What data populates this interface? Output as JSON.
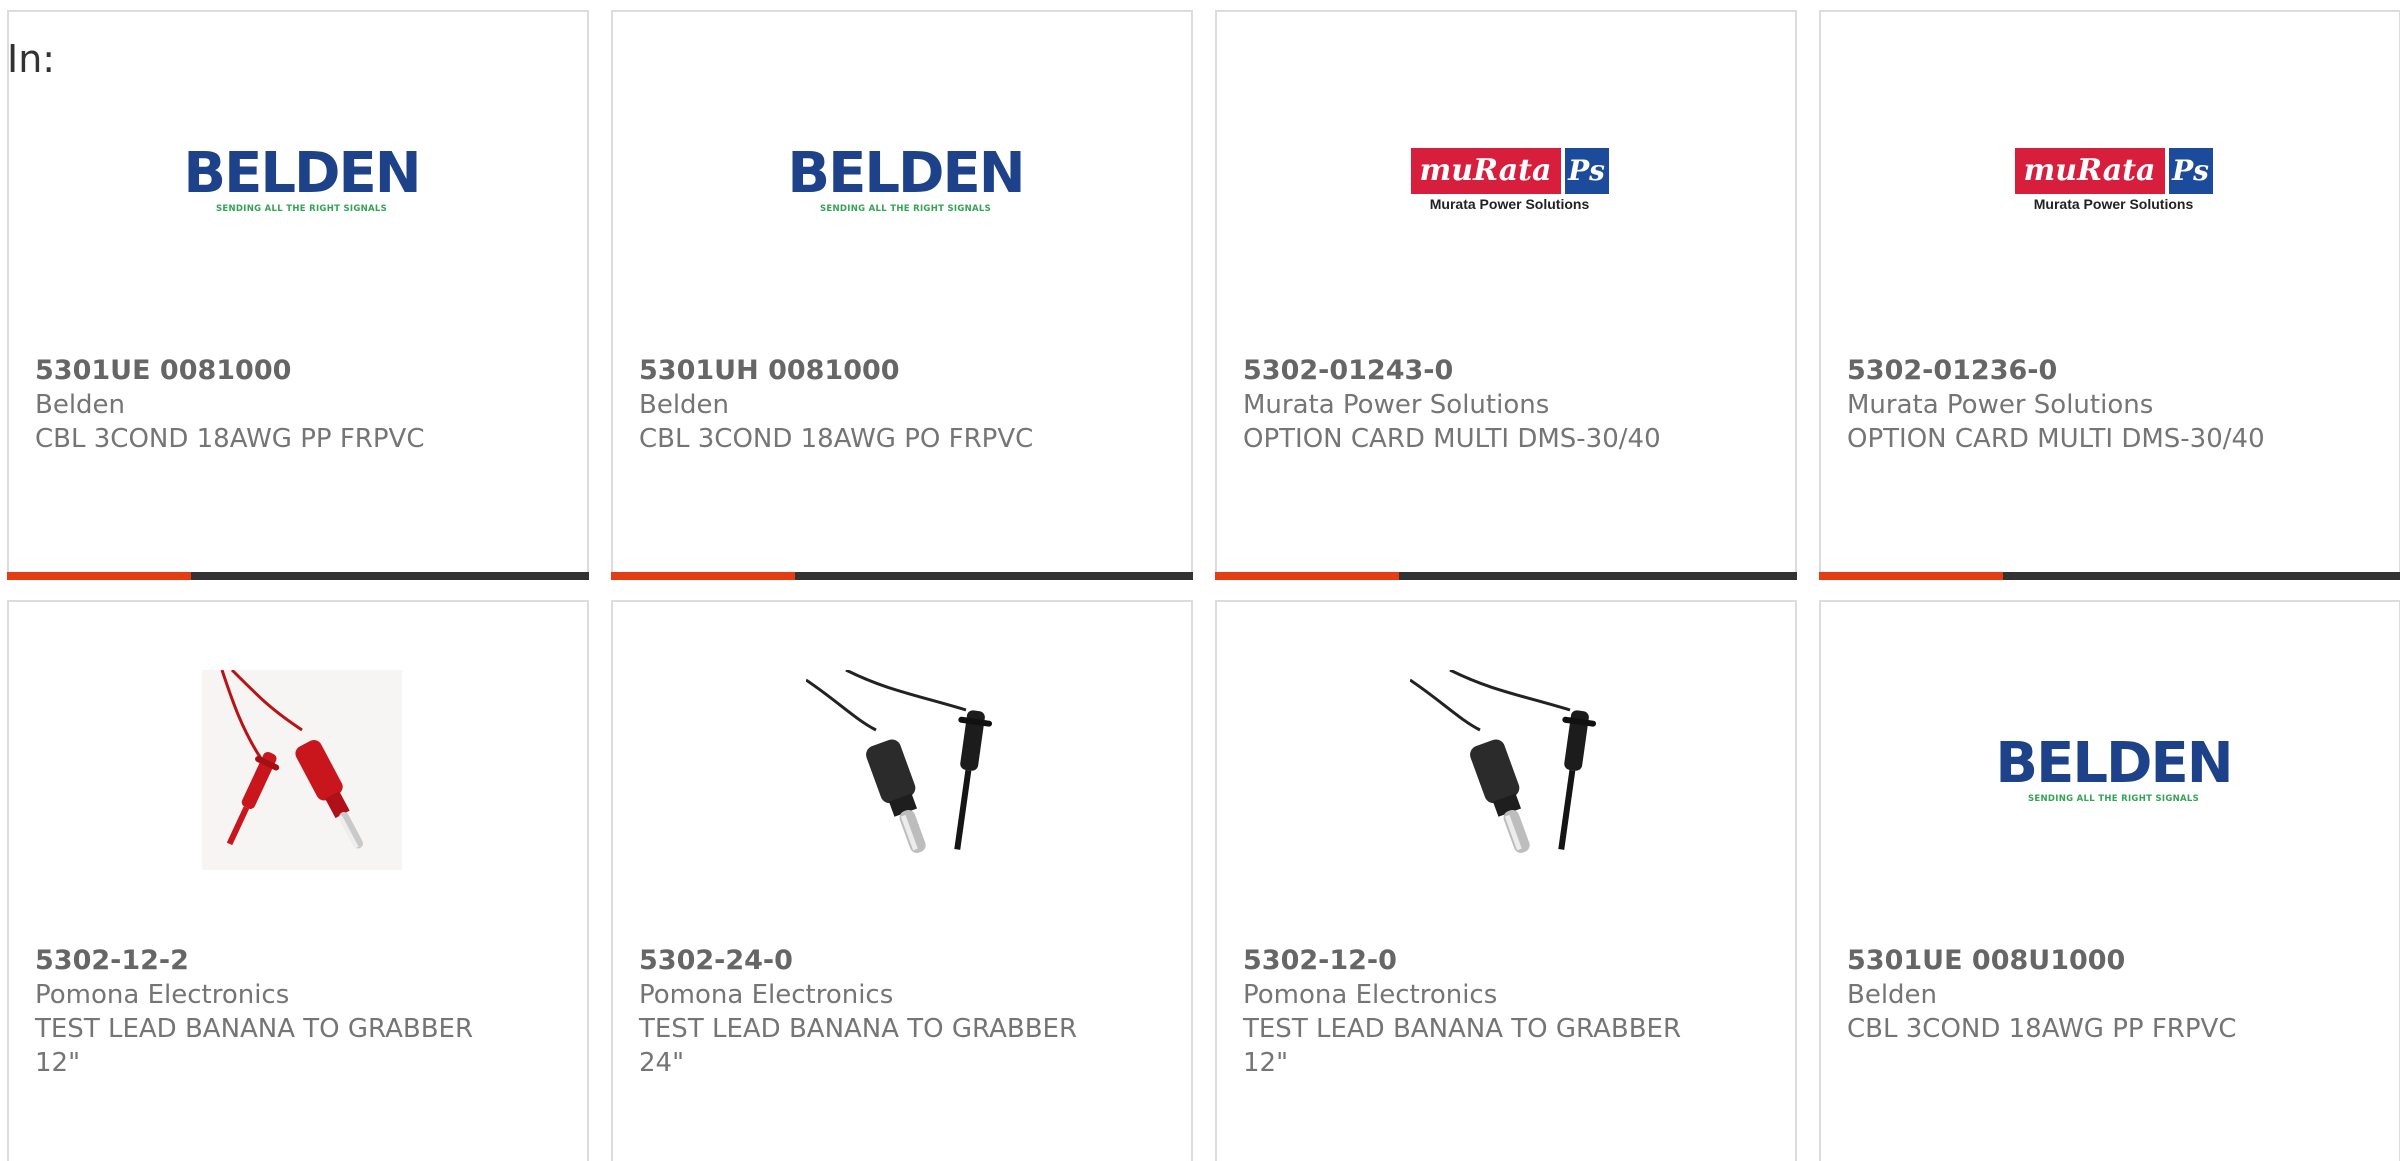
{
  "header": {
    "in_label": "In:"
  },
  "colors": {
    "accent": "#e43d12",
    "bar": "#333333",
    "belden_blue": "#1d4289",
    "belden_green": "#33a455",
    "murata_red": "#d71f3d",
    "murata_blue": "#1d4b9c"
  },
  "logos": {
    "belden": {
      "word": "BELDEN",
      "tagline": "SENDING ALL THE RIGHT SIGNALS"
    },
    "murata": {
      "word": "muRata",
      "mark": "Ps",
      "sub": "Murata Power Solutions"
    }
  },
  "products": [
    {
      "part_number": "5301UE 0081000",
      "manufacturer": "Belden",
      "description": "CBL 3COND 18AWG PP FRPVC",
      "image": "belden-logo"
    },
    {
      "part_number": "5301UH 0081000",
      "manufacturer": "Belden",
      "description": "CBL 3COND 18AWG PO FRPVC",
      "image": "belden-logo"
    },
    {
      "part_number": "5302-01243-0",
      "manufacturer": "Murata Power Solutions",
      "description": "OPTION CARD MULTI DMS-30/40",
      "image": "murata-logo"
    },
    {
      "part_number": "5302-01236-0",
      "manufacturer": "Murata Power Solutions",
      "description": "OPTION CARD MULTI DMS-30/40",
      "image": "murata-logo"
    },
    {
      "part_number": "5302-12-2",
      "manufacturer": "Pomona Electronics",
      "description": "TEST LEAD BANANA TO GRABBER 12\"",
      "image": "red-test-lead-photo"
    },
    {
      "part_number": "5302-24-0",
      "manufacturer": "Pomona Electronics",
      "description": "TEST LEAD BANANA TO GRABBER 24\"",
      "image": "black-test-lead-photo"
    },
    {
      "part_number": "5302-12-0",
      "manufacturer": "Pomona Electronics",
      "description": "TEST LEAD BANANA TO GRABBER 12\"",
      "image": "black-test-lead-photo"
    },
    {
      "part_number": "5301UE 008U1000",
      "manufacturer": "Belden",
      "description": "CBL 3COND 18AWG PP FRPVC",
      "image": "belden-logo"
    }
  ]
}
